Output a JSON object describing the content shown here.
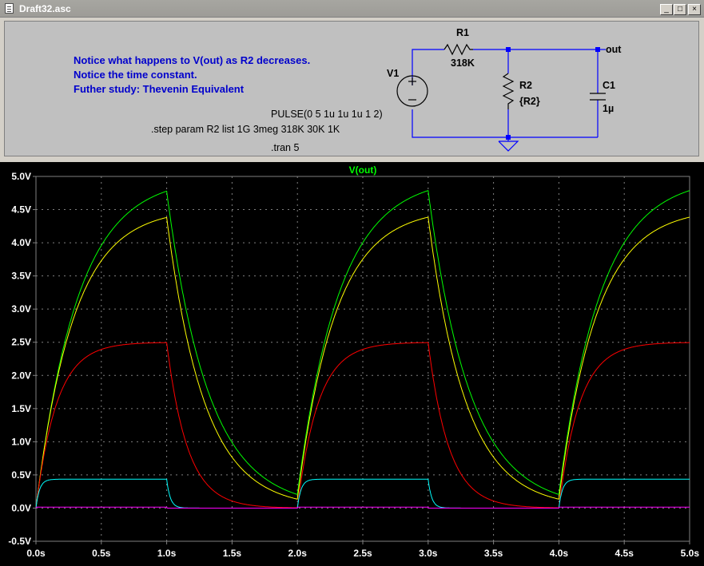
{
  "window": {
    "title": "Draft32.asc",
    "minimize_glyph": "_",
    "maximize_glyph": "□",
    "close_glyph": "×"
  },
  "schematic": {
    "notes": [
      "Notice what happens to V(out) as R2 decreases.",
      "Notice the time constant.",
      "Futher study: Thevenin Equivalent"
    ],
    "source_spec": "PULSE(0 5 1u 1u 1u 1 2)",
    "step_directive": ".step param R2 list 1G 3meg 318K 30K 1K",
    "tran_directive": ".tran 5",
    "components": {
      "r1_name": "R1",
      "r1_value": "318K",
      "r2_name": "R2",
      "r2_value": "{R2}",
      "c1_name": "C1",
      "c1_value": "1µ",
      "v1_name": "V1"
    },
    "net_label": "out",
    "colors": {
      "note_text": "#0000cc",
      "wire": "#0000ff",
      "component": "#000000"
    }
  },
  "waveform": {
    "trace_label": "V(out)",
    "trace_label_color": "#00ff00"
  },
  "chart_data": {
    "type": "line",
    "title": "V(out)",
    "xlabel": "",
    "ylabel": "",
    "xlim": [
      0,
      5
    ],
    "ylim": [
      -0.5,
      5
    ],
    "x_ticks": [
      "0.0s",
      "0.5s",
      "1.0s",
      "1.5s",
      "2.0s",
      "2.5s",
      "3.0s",
      "3.5s",
      "4.0s",
      "4.5s",
      "5.0s"
    ],
    "y_ticks": [
      "-0.5V",
      "0.0V",
      "0.5V",
      "1.0V",
      "1.5V",
      "2.0V",
      "2.5V",
      "3.0V",
      "3.5V",
      "4.0V",
      "4.5V",
      "5.0V"
    ],
    "grid": true,
    "background": "#000000",
    "series": [
      {
        "color": "#00ff00",
        "vinf": 4.9925,
        "tau": 0.3175,
        "vmax": 5.0
      },
      {
        "color": "#ffff00",
        "vinf": 4.5205,
        "tau": 0.287,
        "vmax": 5.0
      },
      {
        "color": "#ff0000",
        "vinf": 2.5,
        "tau": 0.159,
        "vmax": 2.5
      },
      {
        "color": "#00ffff",
        "vinf": 0.4354,
        "tau": 0.0277,
        "vmax": 0.4354
      },
      {
        "color": "#ff00ff",
        "vinf": 0.0157,
        "tau": 0.001,
        "vmax": 0.0157
      }
    ]
  }
}
